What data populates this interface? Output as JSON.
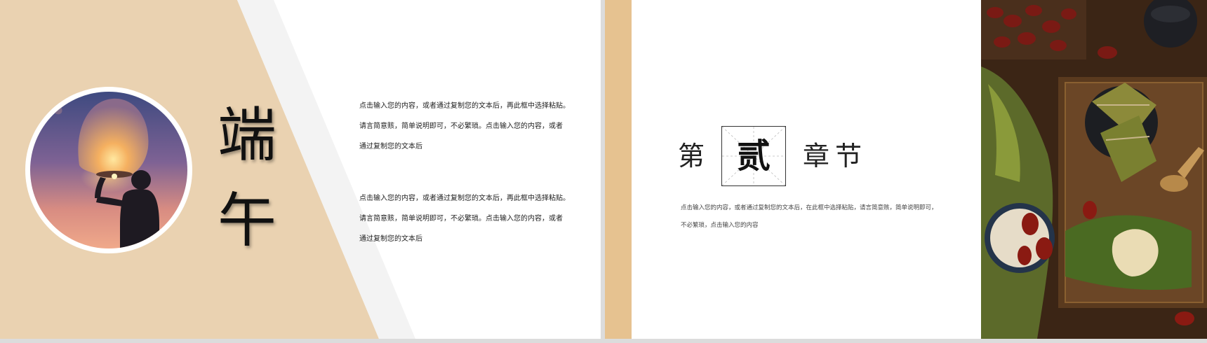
{
  "slide1": {
    "title_chars": [
      "端",
      "午"
    ],
    "paragraph1": [
      "点击输入您的内容，或者通过复制您的文本后，再此框中选择粘贴。",
      "请言简意赅，简单说明即可，不必繁琐。点击输入您的内容，或者",
      "通过复制您的文本后"
    ],
    "paragraph2": [
      "点击输入您的内容，或者通过复制您的文本后，再此框中选择粘贴。",
      "请言简意赅，简单说明即可，不必繁琐。点击输入您的内容，或者",
      "通过复制您的文本后"
    ],
    "colors": {
      "tan": "#ead2b1",
      "light_gray": "#f3f3f3"
    },
    "image": "lantern-photo"
  },
  "slide2": {
    "chapter_prefix": "第",
    "chapter_number": "贰",
    "chapter_suffix": "章节",
    "body": [
      "点击输入您的内容，或者通过复制您的文本后，在此框中选择粘贴，请言简意赅，简单说明即可，",
      "不必繁琐，点击输入您的内容"
    ],
    "colors": {
      "accent": "#e6c290"
    },
    "image": "zongzi-photo"
  }
}
